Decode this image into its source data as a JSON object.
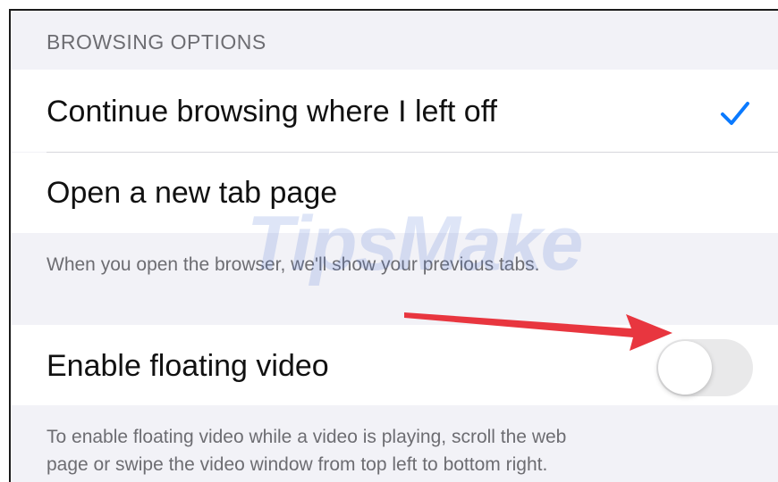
{
  "section": {
    "header": "BROWSING OPTIONS"
  },
  "options": [
    {
      "label": "Continue browsing where I left off",
      "selected": true,
      "check_icon": "checkmark-icon"
    },
    {
      "label": "Open a new tab page",
      "selected": false
    }
  ],
  "options_footer": "When you open the browser, we'll show your previous tabs.",
  "floating_video": {
    "label": "Enable floating video",
    "enabled": false,
    "footer_line1": "To enable floating video while a video is playing, scroll the web",
    "footer_line2": "page or swipe the video window from top left to bottom right."
  },
  "watermark": "TipsMake",
  "colors": {
    "accent": "#0a7aff",
    "annotation_arrow": "#e8363f",
    "toggle_off": "#e9e9ea"
  }
}
